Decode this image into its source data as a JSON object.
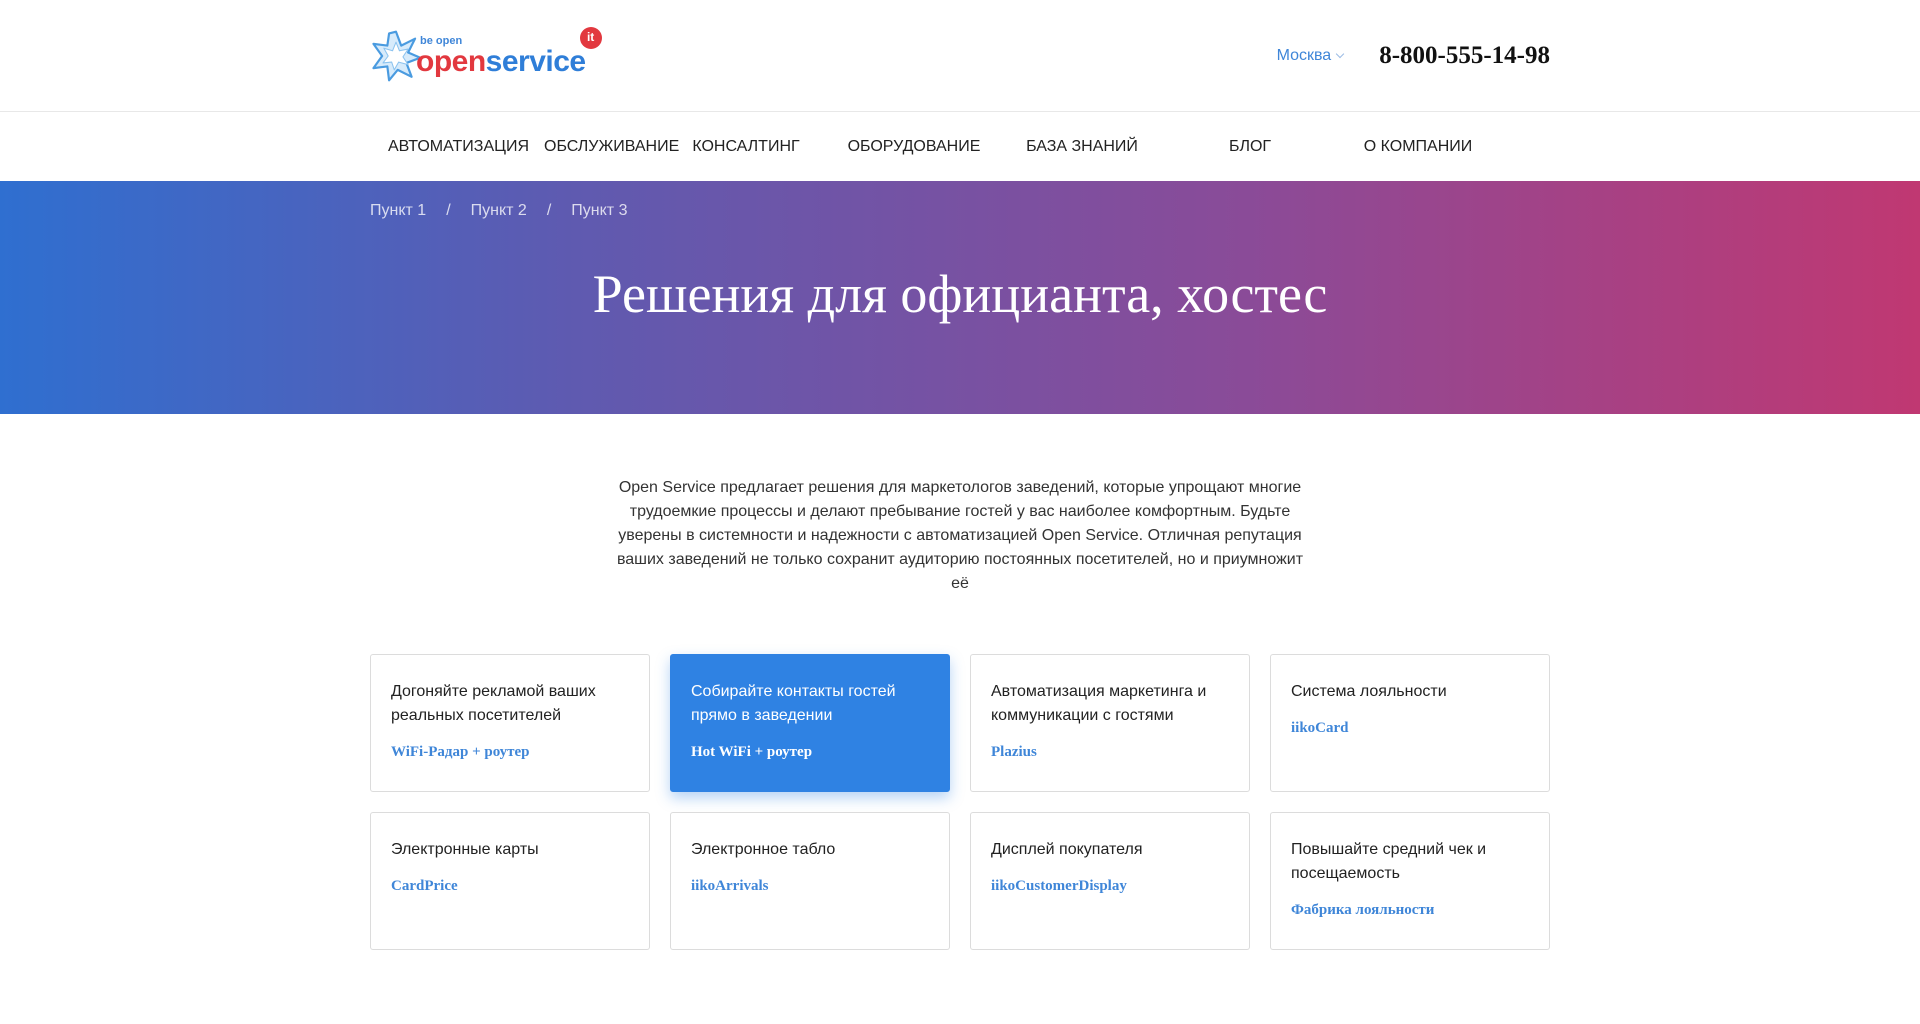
{
  "header": {
    "logo": {
      "tagline": "be open",
      "word_open": "open",
      "word_service": "service",
      "badge": "it"
    },
    "city": "Москва",
    "phone": "8-800-555-14-98"
  },
  "nav": {
    "items": [
      "АВТОМАТИЗАЦИЯ",
      "ОБСЛУЖИВАНИЕ",
      "КОНСАЛТИНГ",
      "ОБОРУДОВАНИЕ",
      "БАЗА ЗНАНИЙ",
      "БЛОГ",
      "О КОМПАНИИ"
    ]
  },
  "hero": {
    "breadcrumbs": [
      "Пункт 1",
      "Пункт 2",
      "Пункт 3"
    ],
    "breadcrumb_separator": "/",
    "title": "Решения для официанта, хостес",
    "gradient": [
      "#2f6fd0",
      "#c03872"
    ]
  },
  "intro": "Open Service предлагает решения для маркетологов заведений, которые упрощают многие трудоемкие процессы и делают пребывание гостей у вас наиболее комфортным. Будьте уверены в системности и надежности с автоматизацией Open Service. Отличная репутация ваших заведений не только сохранит аудиторию постоянных посетителей, но и приумножит её",
  "cards": [
    {
      "desc": "Догоняйте рекламой ваших реальных посетителей",
      "product": "WiFi-Радар + роутер"
    },
    {
      "desc": "Собирайте контакты гостей прямо в заведении",
      "product": "Hot WiFi + роутер",
      "active": true
    },
    {
      "desc": "Автоматизация маркетинга и коммуникации с гостями",
      "product": "Plazius"
    },
    {
      "desc": "Система лояльности",
      "product": "iikoCard"
    },
    {
      "desc": "Электронные карты",
      "product": "CardPrice"
    },
    {
      "desc": "Электронное табло",
      "product": "iikoArrivals"
    },
    {
      "desc": "Дисплей покупателя",
      "product": "iikoCustomerDisplay"
    },
    {
      "desc": "Повышайте средний чек и посещаемость",
      "product": "Фабрика лояльности"
    }
  ],
  "colors": {
    "accent": "#2f82e3",
    "link": "#3f86d8",
    "logo_red": "#e2383f"
  }
}
